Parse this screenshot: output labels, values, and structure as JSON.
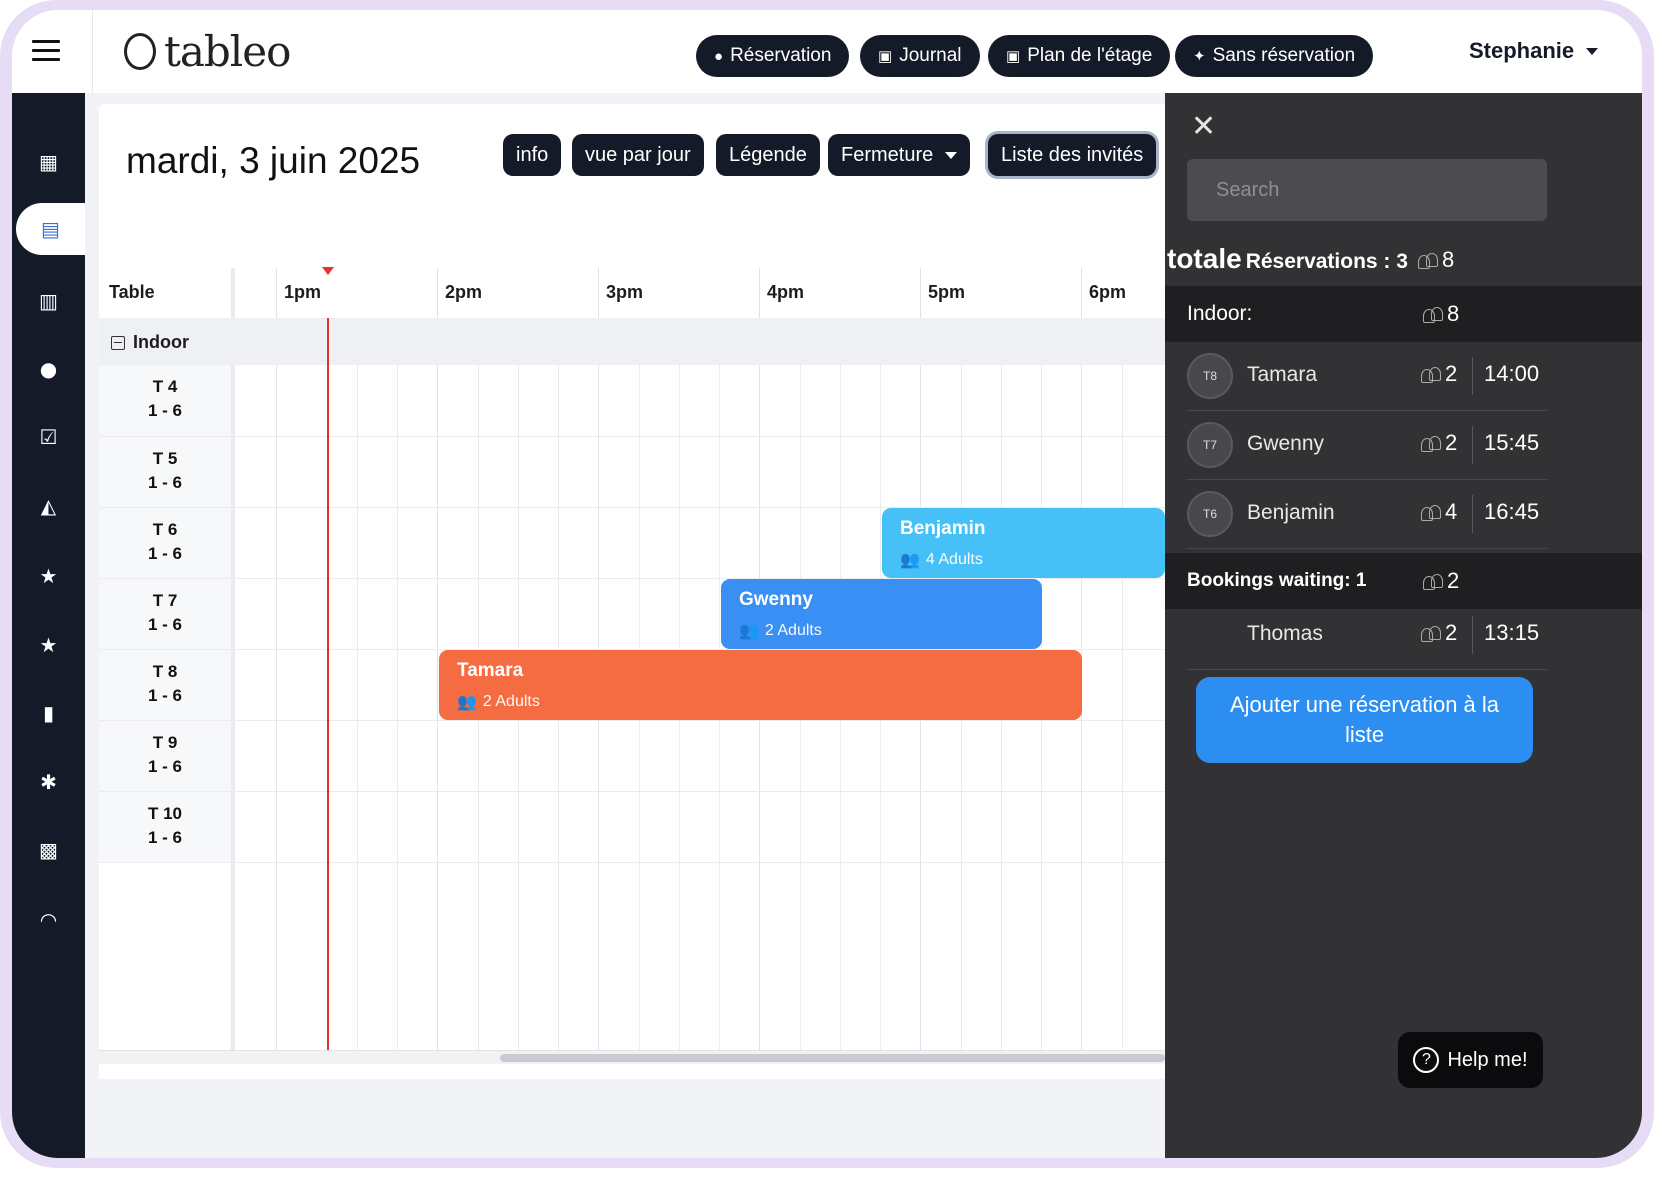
{
  "app": {
    "logo_text": "tableo",
    "user_name": "Stephanie"
  },
  "topnav": [
    {
      "label": "Réservation",
      "icon": "plus-circle-icon",
      "glyph": "●"
    },
    {
      "label": "Journal",
      "icon": "calendar-icon",
      "glyph": "▣"
    },
    {
      "label": "Plan de l'étage",
      "icon": "calendar-icon",
      "glyph": "▣"
    },
    {
      "label": "Sans réservation",
      "icon": "walk-in-icon",
      "glyph": "✦"
    }
  ],
  "sidebar": [
    {
      "icon": "dashboard-icon",
      "glyph": "▦"
    },
    {
      "icon": "calendar-icon",
      "glyph": "▤",
      "active": true
    },
    {
      "icon": "book-icon",
      "glyph": "▥"
    },
    {
      "icon": "user-icon",
      "glyph": "●"
    },
    {
      "icon": "review-icon",
      "glyph": "☑"
    },
    {
      "icon": "chart-icon",
      "glyph": "◭"
    },
    {
      "icon": "star-icon",
      "glyph": "★"
    },
    {
      "icon": "star-icon",
      "glyph": "★"
    },
    {
      "icon": "plus-card-icon",
      "glyph": "▮"
    },
    {
      "icon": "gear-icon",
      "glyph": "✱"
    },
    {
      "icon": "gift-icon",
      "glyph": "▩"
    },
    {
      "icon": "headset-icon",
      "glyph": "◠"
    }
  ],
  "main": {
    "date": "mardi, 3 juin 2025",
    "actions": {
      "info": "info",
      "day_view": "vue par jour",
      "legend": "Légende",
      "closing": "Fermeture",
      "guest_list": "Liste des invités"
    },
    "grid": {
      "table_header": "Table",
      "hours": [
        "1pm",
        "2pm",
        "3pm",
        "4pm",
        "5pm",
        "6pm"
      ],
      "group": "Indoor",
      "tables": [
        {
          "name": "T 4",
          "capacity": "1 - 6"
        },
        {
          "name": "T 5",
          "capacity": "1 - 6"
        },
        {
          "name": "T 6",
          "capacity": "1 - 6"
        },
        {
          "name": "T 7",
          "capacity": "1 - 6"
        },
        {
          "name": "T 8",
          "capacity": "1 - 6"
        },
        {
          "name": "T 9",
          "capacity": "1 - 6"
        },
        {
          "name": "T 10",
          "capacity": "1 - 6"
        }
      ]
    },
    "bookings": [
      {
        "name": "Benjamin",
        "guests": "4 Adults",
        "table": "T 6",
        "color": "#45c1f7"
      },
      {
        "name": "Gwenny",
        "guests": "2 Adults",
        "table": "T 7",
        "color": "#3a8ff5"
      },
      {
        "name": "Tamara",
        "guests": "2 Adults",
        "table": "T 8",
        "color": "#f56c43"
      }
    ]
  },
  "panel": {
    "search_placeholder": "Search",
    "total_prefix": "totale",
    "total_label": "Réservations : 3",
    "total_guests": "8",
    "indoor_label": "Indoor:",
    "indoor_guests": "8",
    "guests": [
      {
        "table": "T8",
        "name": "Tamara",
        "count": "2",
        "time": "14:00"
      },
      {
        "table": "T7",
        "name": "Gwenny",
        "count": "2",
        "time": "15:45"
      },
      {
        "table": "T6",
        "name": "Benjamin",
        "count": "4",
        "time": "16:45"
      }
    ],
    "waiting_label": "Bookings waiting: 1",
    "waiting_guests": "2",
    "waiting": [
      {
        "name": "Thomas",
        "count": "2",
        "time": "13:15"
      }
    ],
    "add_button": "Ajouter une réservation à la liste",
    "help_button": "Help me!"
  },
  "colors": {
    "dark": "#141a27",
    "panel": "#323234",
    "accent": "#2b8ef0",
    "now_line": "#e8312a"
  }
}
